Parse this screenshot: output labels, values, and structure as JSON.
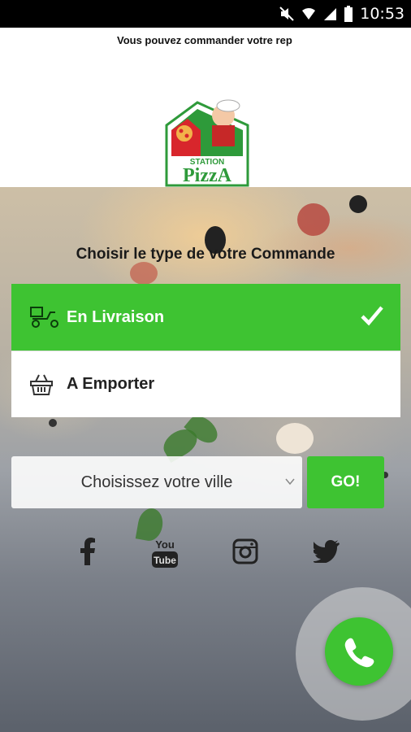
{
  "status_bar": {
    "time": "10:53"
  },
  "marquee": {
    "text": "Vous pouvez commander votre rep"
  },
  "logo": {
    "line1": "STATION",
    "line2": "PizzA"
  },
  "heading": "Choisir le type de votre Commande",
  "order_types": [
    {
      "label": "En Livraison",
      "selected": true,
      "icon": "delivery-scooter-icon"
    },
    {
      "label": "A Emporter",
      "selected": false,
      "icon": "basket-icon"
    }
  ],
  "city_select": {
    "value": "Choisissez votre ville"
  },
  "go_button": {
    "label": "GO!"
  },
  "social": [
    {
      "name": "facebook",
      "icon": "facebook-icon"
    },
    {
      "name": "youtube",
      "icon": "youtube-icon",
      "text_top": "You",
      "text_bottom": "Tube"
    },
    {
      "name": "instagram",
      "icon": "instagram-icon"
    },
    {
      "name": "twitter",
      "icon": "twitter-icon"
    }
  ],
  "colors": {
    "accent": "#3ec332",
    "status_bar": "#000000"
  }
}
